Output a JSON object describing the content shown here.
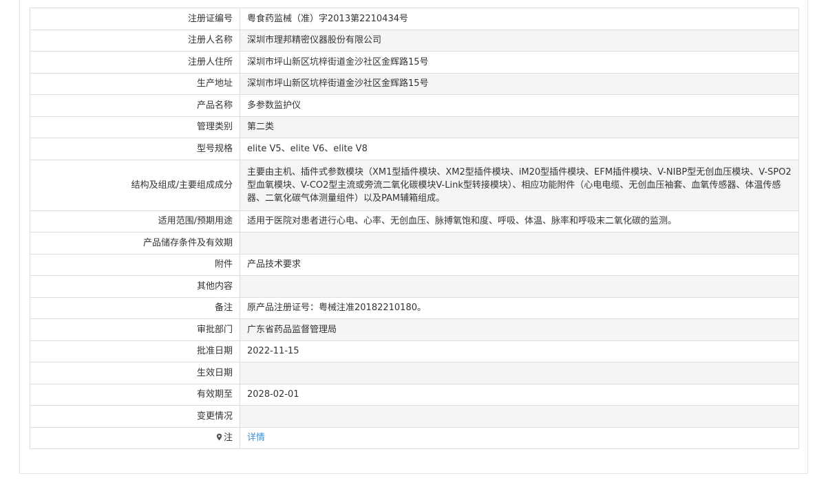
{
  "rows": [
    {
      "label": "注册证编号",
      "value": "粤食药监械（准）字2013第2210434号"
    },
    {
      "label": "注册人名称",
      "value": "深圳市理邦精密仪器股份有限公司"
    },
    {
      "label": "注册人住所",
      "value": "深圳市坪山新区坑梓街道金沙社区金辉路15号"
    },
    {
      "label": "生产地址",
      "value": "深圳市坪山新区坑梓街道金沙社区金辉路15号"
    },
    {
      "label": "产品名称",
      "value": "多参数监护仪"
    },
    {
      "label": "管理类别",
      "value": "第二类"
    },
    {
      "label": "型号规格",
      "value": "elite V5、elite V6、elite V8"
    },
    {
      "label": "结构及组成/主要组成成分",
      "value": "主要由主机、插件式参数模块（XM1型插件模块、XM2型插件模块、iM20型插件模块、EFM插件模块、V-NIBP型无创血压模块、V-SPO2型血氧模块、V-CO2型主流或旁流二氧化碳模块V-Link型转接模块）、相应功能附件（心电电缆、无创血压袖套、血氧传感器、体温传感器、二氧化碳气体测量组件）以及PAM辅箱组成。"
    },
    {
      "label": "适用范围/预期用途",
      "value": "适用于医院对患者进行心电、心率、无创血压、脉搏氧饱和度、呼吸、体温、脉率和呼吸末二氧化碳的监测。"
    },
    {
      "label": "产品储存条件及有效期",
      "value": ""
    },
    {
      "label": "附件",
      "value": "产品技术要求"
    },
    {
      "label": "其他内容",
      "value": ""
    },
    {
      "label": "备注",
      "value": "原产品注册证号：粤械注准20182210180。"
    },
    {
      "label": "审批部门",
      "value": "广东省药品监督管理局"
    },
    {
      "label": "批准日期",
      "value": "2022-11-15"
    },
    {
      "label": "生效日期",
      "value": ""
    },
    {
      "label": "有效期至",
      "value": "2028-02-01"
    },
    {
      "label": "变更情况",
      "value": ""
    },
    {
      "label": "注",
      "value": "详情",
      "icon": "pin-icon"
    }
  ],
  "colors": {
    "link": "#3d8fd1",
    "border": "#dddddd",
    "alt_row": "#f5f5f5"
  }
}
